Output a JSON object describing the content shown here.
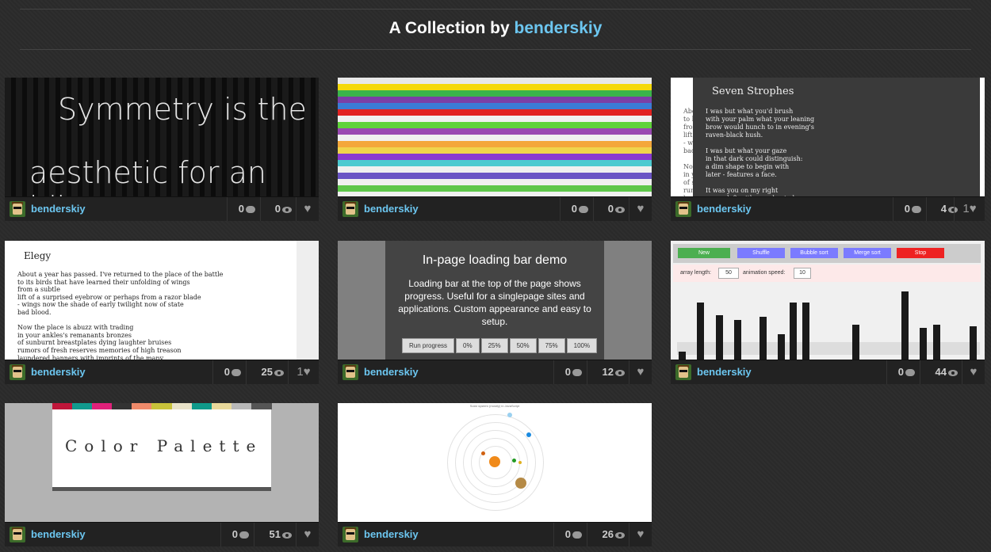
{
  "header": {
    "prefix": "A Collection by",
    "author": "benderskiy"
  },
  "cards": [
    {
      "user": "benderskiy",
      "comments": "0",
      "views": "0",
      "likes": "",
      "thumb": {
        "line1": "Symmetry is the",
        "line2": "aesthetic for an idiot"
      }
    },
    {
      "user": "benderskiy",
      "comments": "0",
      "views": "0",
      "likes": "",
      "thumb": {
        "stripes": [
          "#e8e8e8",
          "#f5d90a",
          "#3ab54a",
          "#7b3fa6",
          "#3b7bd6",
          "#e22222",
          "#f0f0f0",
          "#5fd33a",
          "#9a49b2",
          "#f0f0f0",
          "#f4a73a",
          "#f0d44b",
          "#8a3ad0",
          "#4ccad0",
          "#f0f0f0",
          "#6a55c5",
          "#f0f0f0",
          "#5ec74a",
          "#f0f0f0"
        ]
      }
    },
    {
      "user": "benderskiy",
      "comments": "0",
      "views": "4",
      "likes": "1",
      "thumb": {
        "title": "Seven Strophes",
        "body": "I was but what you'd brush\nwith your palm what your leaning\nbrow would hunch to in evening's\nraven-black hush.\n\nI was but what your gaze\nin that dark could distinguish:\na dim shape to begin with\nlater - features a face.\n\nIt was you on my right\non my left with your heated",
        "left": "Abo\nto h\nfro\nlift\n- w\nbad\n\nNo\nin y\nof s\nrum\nlau"
      }
    },
    {
      "user": "benderskiy",
      "comments": "0",
      "views": "25",
      "likes": "1",
      "thumb": {
        "title": "Elegy",
        "body": "About a year has passed. I've returned to the place of the battle\nto its birds that have learned their unfolding of wings\nfrom a subtle\nlift of a surprised eyebrow or perhaps from a razor blade\n- wings now the shade of early twilight now of state\nbad blood.\n\nNow the place is abuzz with trading\nin your ankles's remanants bronzes\nof sunburnt breastplates dying laughter bruises\nrumors of fresh reserves memories of high treason\nlaundered banners with imprints of the many"
      }
    },
    {
      "user": "benderskiy",
      "comments": "0",
      "views": "12",
      "likes": "",
      "thumb": {
        "title": "In-page loading bar demo",
        "desc": "Loading bar at the top of the page shows progress. Useful for a singlepage sites and applications. Custom appearance and easy to setup.",
        "buttons": [
          "Run progress",
          "0%",
          "25%",
          "50%",
          "75%",
          "100%"
        ]
      }
    },
    {
      "user": "benderskiy",
      "comments": "0",
      "views": "44",
      "likes": "",
      "thumb": {
        "buttons": [
          "New",
          "Shuffle",
          "Bubble sort",
          "Merge sort",
          "Stop"
        ],
        "array_label": "array length:",
        "array_value": "50",
        "speed_label": "animation speed:",
        "speed_value": "10"
      }
    },
    {
      "user": "benderskiy",
      "comments": "0",
      "views": "51",
      "likes": "",
      "thumb": {
        "title": "Color Palette",
        "stripes": [
          "#c0163a",
          "#119a8e",
          "#e0217a",
          "#333333",
          "#ef8a6a",
          "#c8c23a",
          "#e8e2c8",
          "#0f9a8a",
          "#e8d89a",
          "#b8b8b8",
          "#555555"
        ]
      }
    },
    {
      "user": "benderskiy",
      "comments": "0",
      "views": "26",
      "likes": "",
      "thumb": {
        "caption": "Solar system (mostly) in JavaScript"
      }
    }
  ]
}
